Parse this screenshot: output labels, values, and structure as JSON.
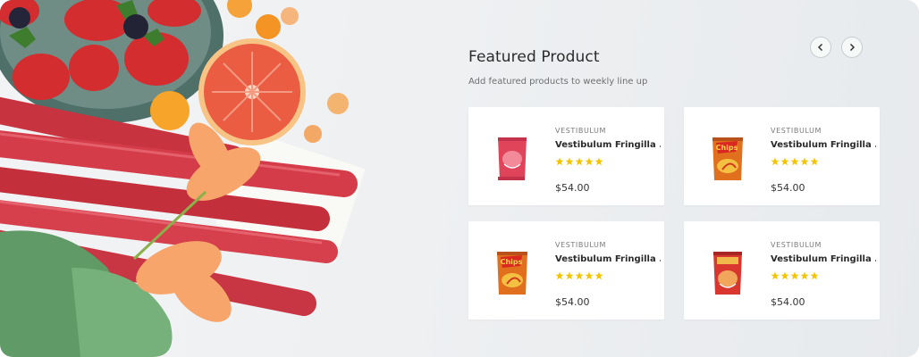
{
  "section": {
    "title": "Featured Product",
    "subtitle": "Add featured products to weekly line up"
  },
  "nav": {
    "prev_icon": "chevron-left-icon",
    "next_icon": "chevron-right-icon"
  },
  "rating_color": "#f5c400",
  "products": [
    {
      "category": "VESTIBULUM",
      "name": "Vestibulum Fringilla ...",
      "price": "$54.00",
      "rating": 5,
      "image": "snack-bag-red-icon"
    },
    {
      "category": "VESTIBULUM",
      "name": "Vestibulum Fringilla ...",
      "price": "$54.00",
      "rating": 5,
      "image": "chips-bag-icon"
    },
    {
      "category": "VESTIBULUM",
      "name": "Vestibulum Fringilla ...",
      "price": "$54.00",
      "rating": 5,
      "image": "chips-bag-icon"
    },
    {
      "category": "VESTIBULUM",
      "name": "Vestibulum Fringilla ...",
      "price": "$54.00",
      "rating": 5,
      "image": "snack-bag-red-icon"
    }
  ]
}
